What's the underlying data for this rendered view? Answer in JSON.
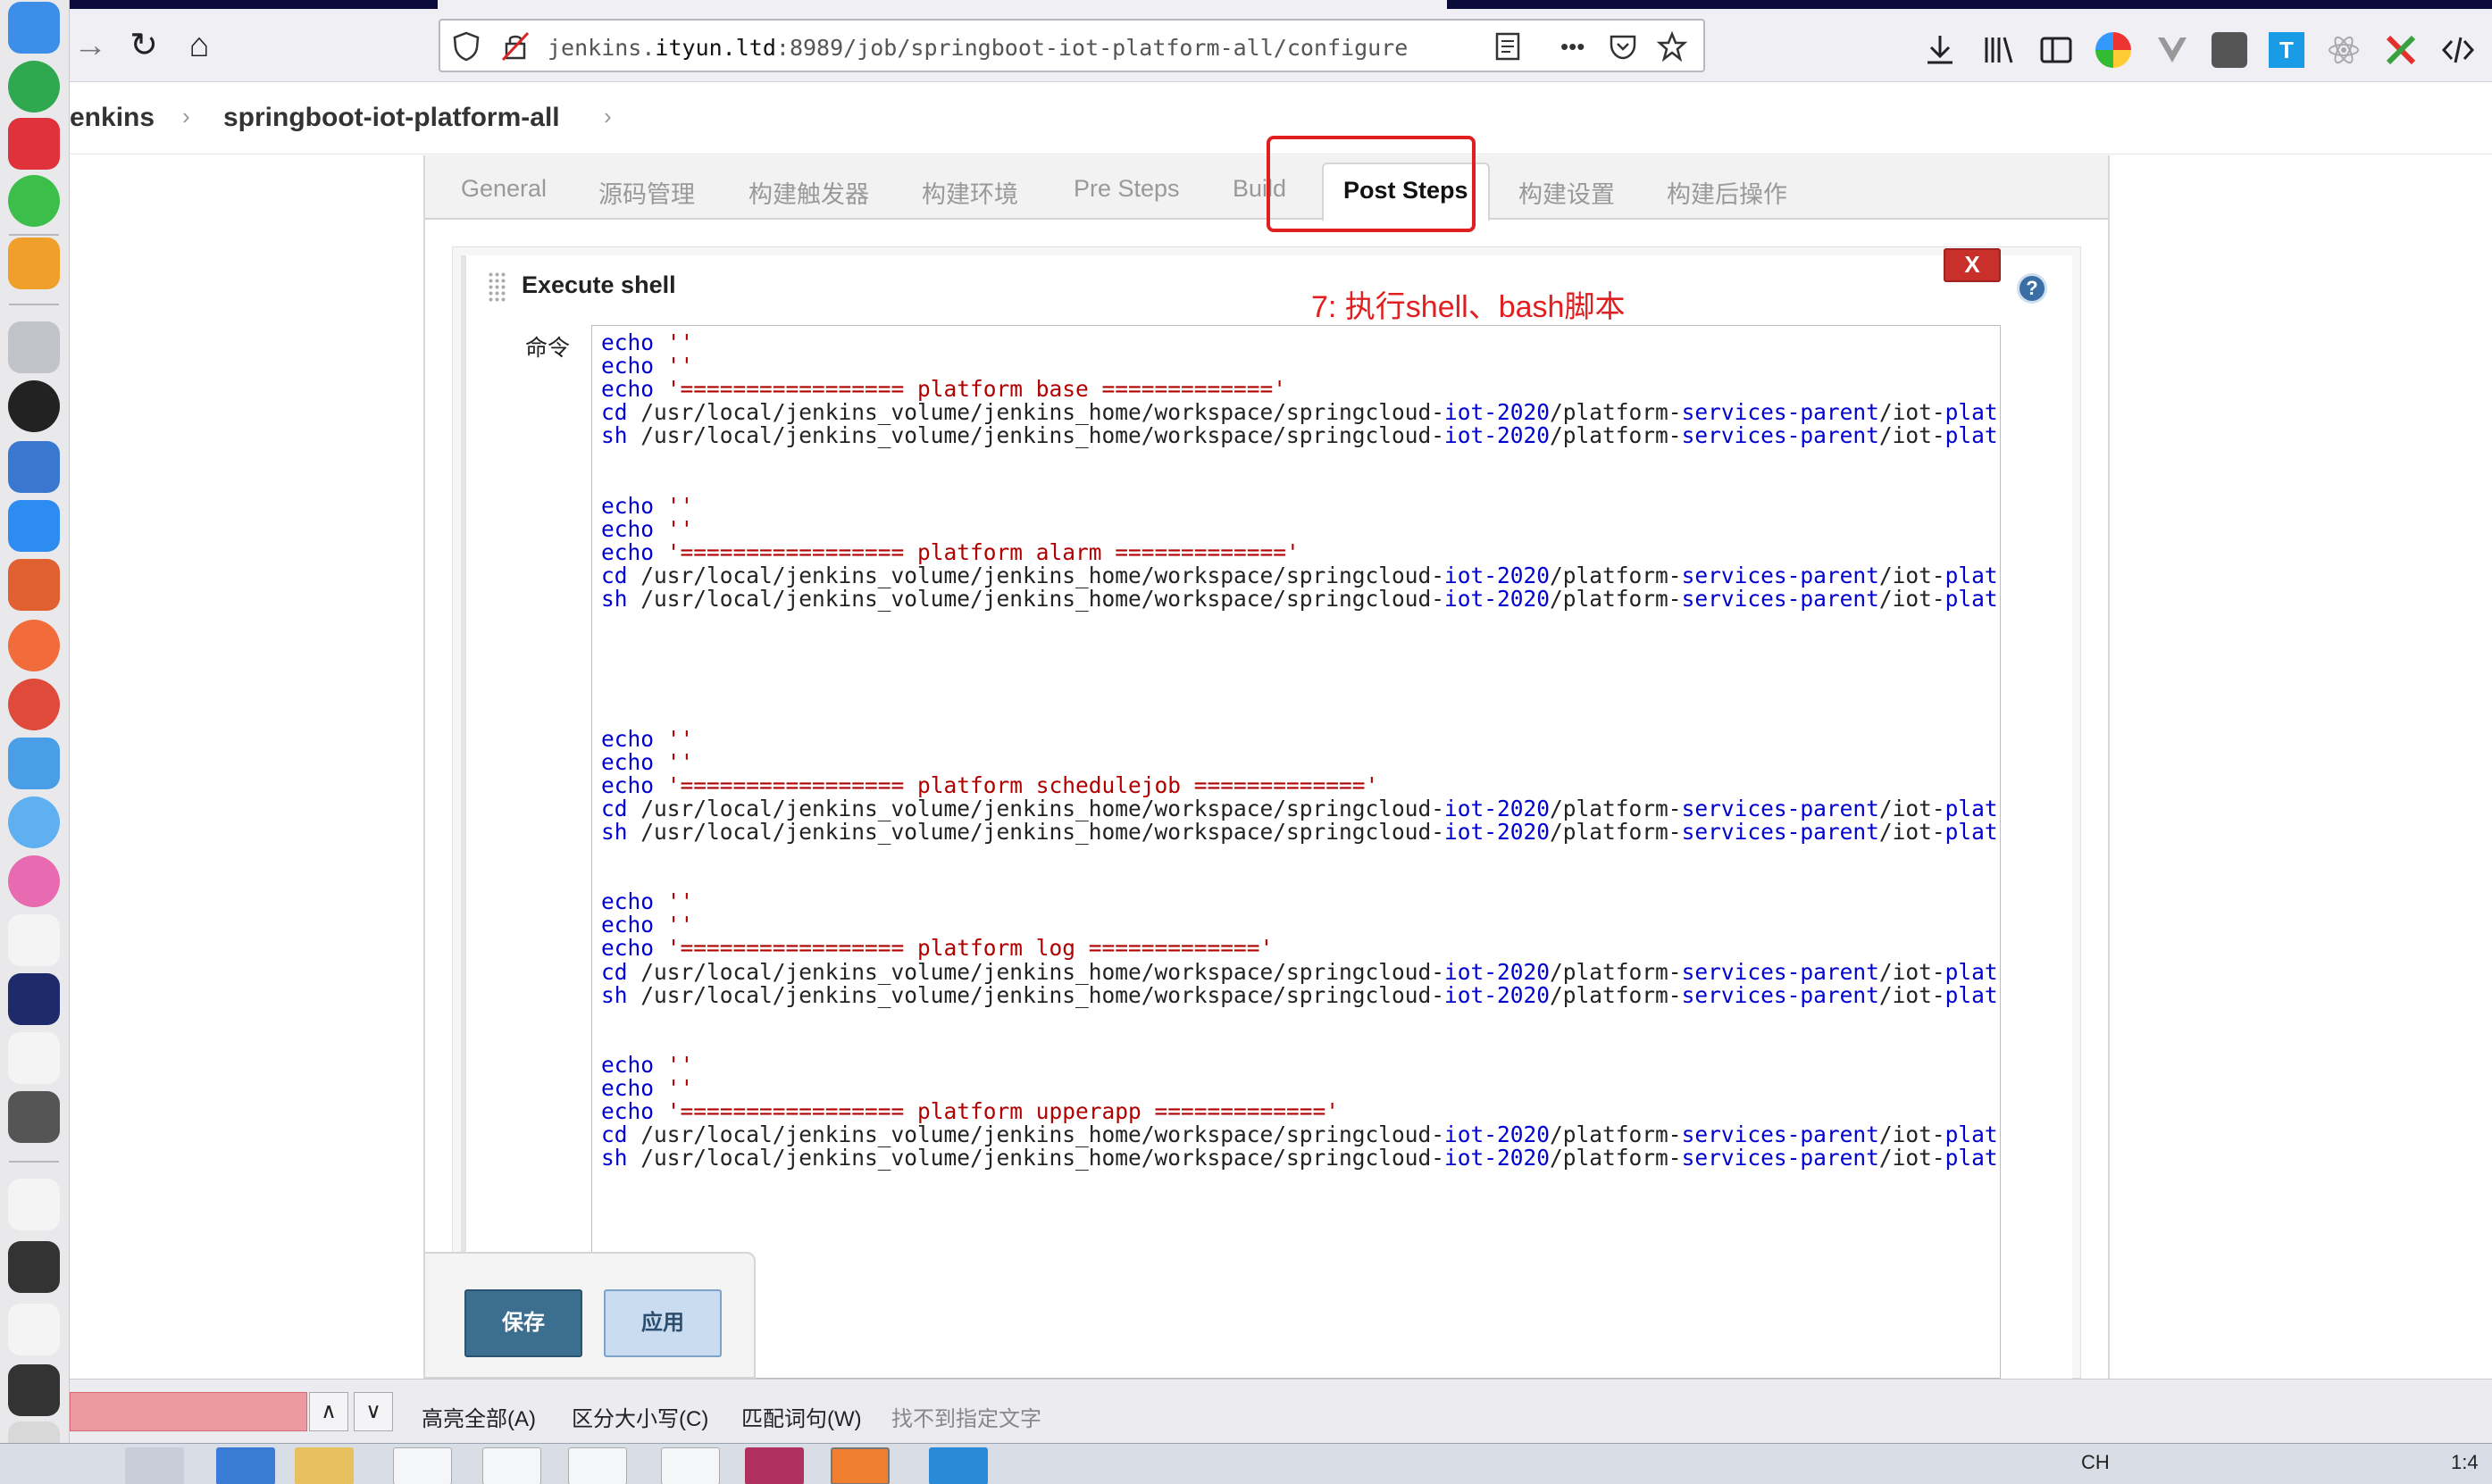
{
  "browser": {
    "url_prefix": "jenkins.",
    "url_domain": "ityun.ltd",
    "url_rest": ":8989/job/springboot-iot-platform-all/configure",
    "more_label": "•••"
  },
  "breadcrumb": {
    "root": "enkins",
    "job": "springboot-iot-platform-all",
    "sep": "›"
  },
  "tabs": [
    {
      "label": "General"
    },
    {
      "label": "源码管理"
    },
    {
      "label": "构建触发器"
    },
    {
      "label": "构建环境"
    },
    {
      "label": "Pre Steps"
    },
    {
      "label": "Build"
    },
    {
      "label": "Post Steps"
    },
    {
      "label": "构建设置"
    },
    {
      "label": "构建后操作"
    }
  ],
  "step": {
    "title": "Execute shell",
    "close_label": "X",
    "help_label": "?",
    "command_label": "命令",
    "annotation": "7: 执行shell、bash脚本"
  },
  "shell": {
    "blocks": [
      {
        "name": "platform base",
        "banner": "'================= platform base ============='"
      },
      {
        "name": "platform alarm",
        "banner": "'================= platform alarm ============='"
      },
      {
        "name": "platform schedulejob",
        "banner": "'================= platform schedulejob ============='"
      },
      {
        "name": "platform log",
        "banner": "'================= platform log ============='"
      },
      {
        "name": "platform upperapp",
        "banner": "'================= platform upperapp ============='"
      }
    ],
    "echo_kw": "echo",
    "cd_kw": "cd",
    "sh_kw": "sh",
    "empty_str": "''",
    "path_a": " /usr/local/jenkins_volume/jenkins_home/workspace/springcloud-",
    "path_b": "iot-2020",
    "path_c": "/platform-",
    "path_d": "services-parent",
    "path_e": "/iot-",
    "path_f": "platform-c"
  },
  "buttons": {
    "save": "保存",
    "apply": "应用"
  },
  "findbar": {
    "up": "∧",
    "down": "∨",
    "highlight_all": "高亮全部(A)",
    "match_case": "区分大小写(C)",
    "whole_words": "匹配词句(W)",
    "status": "找不到指定文字"
  },
  "taskbar": {
    "ime": "CH",
    "clock": "1:4"
  }
}
